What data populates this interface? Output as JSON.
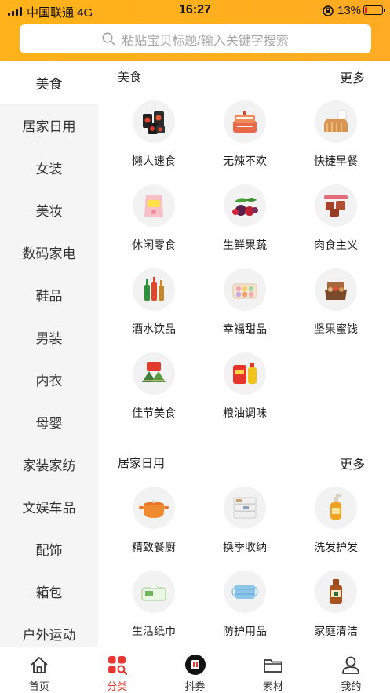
{
  "status_bar": {
    "carrier": "中国联通  4G",
    "time": "16:27",
    "battery": "13%",
    "battery_level": 0.13
  },
  "search": {
    "placeholder": "粘贴宝贝标题/输入关键字搜索"
  },
  "colors": {
    "brand": "#ffb01c",
    "active_tab": "#e8372f"
  },
  "sidebar": {
    "items": [
      "美食",
      "居家日用",
      "女装",
      "美妆",
      "数码家电",
      "鞋品",
      "男装",
      "内衣",
      "母婴",
      "家装家纺",
      "文娱车品",
      "配饰",
      "箱包",
      "户外运动"
    ],
    "active_index": 0
  },
  "sections": [
    {
      "title": "美食",
      "more": "更多",
      "items": [
        {
          "label": "懒人速食",
          "icon": "instant-noodles-image"
        },
        {
          "label": "无辣不欢",
          "icon": "spicy-meat-image"
        },
        {
          "label": "快捷早餐",
          "icon": "bread-milk-image"
        },
        {
          "label": "休闲零食",
          "icon": "snack-bag-image"
        },
        {
          "label": "生鲜果蔬",
          "icon": "fruits-image"
        },
        {
          "label": "肉食主义",
          "icon": "braised-meat-image"
        },
        {
          "label": "酒水饮品",
          "icon": "drink-bottles-image"
        },
        {
          "label": "幸福甜品",
          "icon": "macaron-box-image"
        },
        {
          "label": "坚果蜜饯",
          "icon": "nut-box-image"
        },
        {
          "label": "佳节美食",
          "icon": "zongzi-image"
        },
        {
          "label": "粮油调味",
          "icon": "rice-oil-image"
        }
      ]
    },
    {
      "title": "居家日用",
      "more": "更多",
      "items": [
        {
          "label": "精致餐厨",
          "icon": "cooking-pot-image"
        },
        {
          "label": "换季收纳",
          "icon": "storage-drawers-image"
        },
        {
          "label": "洗发护发",
          "icon": "shampoo-bottle-image"
        },
        {
          "label": "生活纸巾",
          "icon": "tissue-pack-image"
        },
        {
          "label": "防护用品",
          "icon": "face-mask-image"
        },
        {
          "label": "家庭清洁",
          "icon": "disinfectant-bottle-image"
        }
      ]
    }
  ],
  "tabbar": {
    "items": [
      {
        "label": "首页",
        "icon": "home-icon"
      },
      {
        "label": "分类",
        "icon": "category-icon"
      },
      {
        "label": "抖券",
        "icon": "douyin-coupon-icon"
      },
      {
        "label": "素材",
        "icon": "folder-icon"
      },
      {
        "label": "我的",
        "icon": "profile-icon"
      }
    ],
    "active_index": 1
  }
}
